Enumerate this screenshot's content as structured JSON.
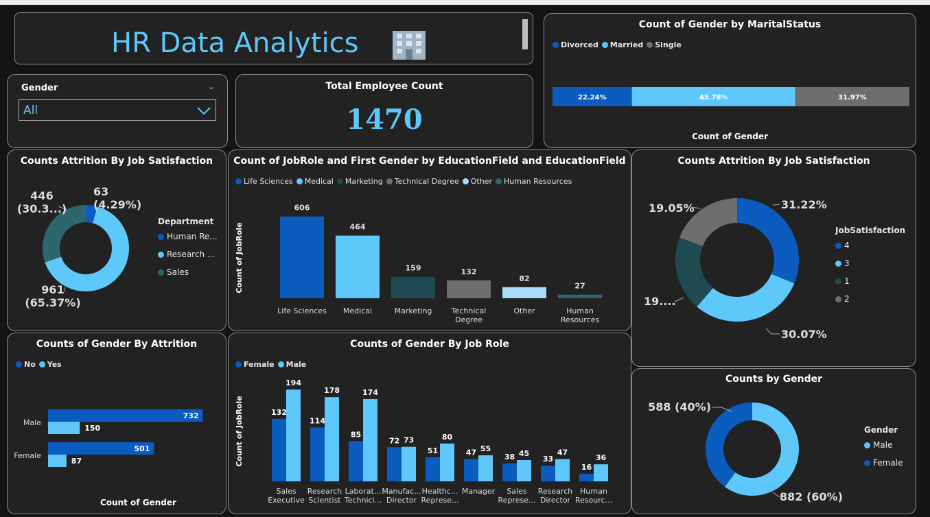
{
  "header": {
    "title": "HR Data Analytics"
  },
  "filter": {
    "label": "Gender",
    "value": "All"
  },
  "kpi": {
    "title": "Total Employee Count",
    "value": "1470"
  },
  "colors": {
    "dark_blue": "#0b5cbe",
    "light_blue": "#5ec8fa",
    "dark_teal": "#1f4a52",
    "teal": "#2e6670",
    "gray": "#6e6e6e",
    "pale_blue": "#a8dcfb",
    "background": "#222222"
  },
  "chart_data": [
    {
      "id": "marital",
      "type": "bar",
      "orientation": "horizontal-stacked-100",
      "title": "Count of Gender by MaritalStatus",
      "xlabel": "Count of Gender",
      "series": [
        {
          "name": "Divorced",
          "value": 22.24,
          "label": "22.24%",
          "color": "#0b5cbe"
        },
        {
          "name": "Married",
          "value": 45.78,
          "label": "45.78%",
          "color": "#5ec8fa"
        },
        {
          "name": "Single",
          "value": 31.97,
          "label": "31.97%",
          "color": "#6e6e6e"
        }
      ]
    },
    {
      "id": "dept_donut",
      "type": "pie",
      "title": "Counts Attrition By Job Satisfaction",
      "legend_title": "Department",
      "slices": [
        {
          "name": "Human Re...",
          "value": 63,
          "label1": "63",
          "label2": "(4.29%)",
          "color": "#0b5cbe"
        },
        {
          "name": "Research ...",
          "value": 961,
          "label1": "961",
          "label2": "(65.37%)",
          "color": "#5ec8fa"
        },
        {
          "name": "Sales",
          "value": 446,
          "label1": "446",
          "label2": "(30.3...)",
          "color": "#2e6670"
        }
      ]
    },
    {
      "id": "edu",
      "type": "bar",
      "title": "Count of JobRole and First Gender by EducationField and EducationField",
      "ylabel": "Count of JobRole",
      "ylim": [
        0,
        650
      ],
      "legend": [
        {
          "name": "Life Sciences",
          "color": "#0b5cbe"
        },
        {
          "name": "Medical",
          "color": "#5ec8fa"
        },
        {
          "name": "Marketing",
          "color": "#1f4a52"
        },
        {
          "name": "Technical Degree",
          "color": "#6e6e6e"
        },
        {
          "name": "Other",
          "color": "#a8dcfb"
        },
        {
          "name": "Human Resources",
          "color": "#2e6670"
        }
      ],
      "bars": [
        {
          "category": [
            "Life Sciences"
          ],
          "value": 606,
          "label": "606",
          "color": "#0b5cbe"
        },
        {
          "category": [
            "Medical"
          ],
          "value": 464,
          "label": "464",
          "color": "#5ec8fa"
        },
        {
          "category": [
            "Marketing"
          ],
          "value": 159,
          "label": "159",
          "color": "#1f4a52"
        },
        {
          "category": [
            "Technical",
            "Degree"
          ],
          "value": 132,
          "label": "132",
          "color": "#6e6e6e"
        },
        {
          "category": [
            "Other"
          ],
          "value": 82,
          "label": "82",
          "color": "#a8dcfb"
        },
        {
          "category": [
            "Human",
            "Resources"
          ],
          "value": 27,
          "label": "27",
          "color": "#2e6670"
        }
      ]
    },
    {
      "id": "jobsat",
      "type": "pie",
      "title": "Counts Attrition By Job Satisfaction",
      "legend_title": "JobSatisfaction",
      "slices": [
        {
          "name": "4",
          "value": 31.22,
          "label": "31.22%",
          "color": "#0b5cbe"
        },
        {
          "name": "3",
          "value": 30.07,
          "label": "30.07%",
          "color": "#5ec8fa"
        },
        {
          "name": "1",
          "value": 19.66,
          "label": "19....",
          "color": "#1f4a52"
        },
        {
          "name": "2",
          "value": 19.05,
          "label": "19.05%",
          "color": "#6e6e6e"
        }
      ]
    },
    {
      "id": "attrition",
      "type": "bar",
      "orientation": "horizontal",
      "title": "Counts of Gender By Attrition",
      "xlabel": "Count of Gender",
      "xlim": [
        0,
        740
      ],
      "categories": [
        "Male",
        "Female"
      ],
      "series": [
        {
          "name": "No",
          "values": [
            732,
            501
          ],
          "color": "#0b5cbe"
        },
        {
          "name": "Yes",
          "values": [
            150,
            87
          ],
          "color": "#5ec8fa"
        }
      ]
    },
    {
      "id": "jobrole",
      "type": "bar",
      "title": "Counts of Gender By Job Role",
      "ylabel": "Count of JobRole",
      "ylim": [
        0,
        200
      ],
      "categories": [
        [
          "Sales",
          "Executive"
        ],
        [
          "Research",
          "Scientist"
        ],
        [
          "Laborat...",
          "Technici..."
        ],
        [
          "Manufac...",
          "Director"
        ],
        [
          "Healthc...",
          "Represe..."
        ],
        [
          "Manager"
        ],
        [
          "Sales",
          "Represe..."
        ],
        [
          "Research",
          "Director"
        ],
        [
          "Human",
          "Resourc..."
        ]
      ],
      "series": [
        {
          "name": "Female",
          "values": [
            132,
            114,
            85,
            72,
            51,
            47,
            38,
            33,
            16
          ],
          "color": "#0b5cbe"
        },
        {
          "name": "Male",
          "values": [
            194,
            178,
            174,
            73,
            80,
            55,
            45,
            47,
            36
          ],
          "color": "#5ec8fa"
        }
      ]
    },
    {
      "id": "gender_donut",
      "type": "pie",
      "title": "Counts by Gender",
      "legend_title": "Gender",
      "slices": [
        {
          "name": "Male",
          "value": 882,
          "label": "882 (60%)",
          "color": "#5ec8fa"
        },
        {
          "name": "Female",
          "value": 588,
          "label": "588 (40%)",
          "color": "#0b5cbe"
        }
      ]
    }
  ]
}
